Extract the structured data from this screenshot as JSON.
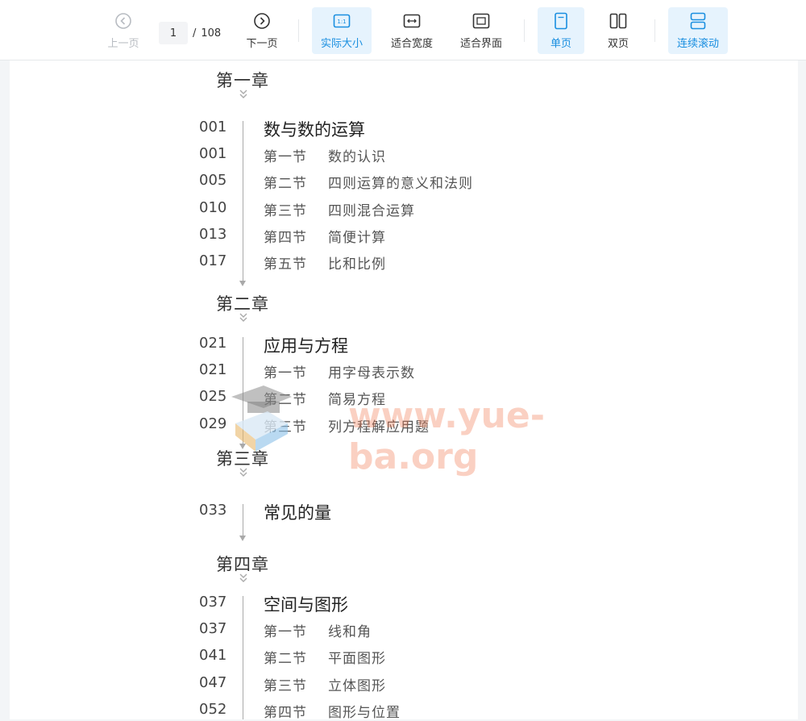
{
  "toolbar": {
    "prev_label": "上一页",
    "next_label": "下一页",
    "current_page": "1",
    "total_pages": "108",
    "actual_size_label": "实际大小",
    "actual_size_icon_text": "1:1",
    "fit_width_label": "适合宽度",
    "fit_screen_label": "适合界面",
    "single_page_label": "单页",
    "double_page_label": "双页",
    "continuous_scroll_label": "连续滚动",
    "accent_color": "#1a8fe0"
  },
  "toc": {
    "chapters": [
      {
        "title": "第一章",
        "main": {
          "page": "001",
          "title": "数与数的运算"
        },
        "sections": [
          {
            "page": "001",
            "label": "第一节",
            "title": "数的认识"
          },
          {
            "page": "005",
            "label": "第二节",
            "title": "四则运算的意义和法则"
          },
          {
            "page": "010",
            "label": "第三节",
            "title": "四则混合运算"
          },
          {
            "page": "013",
            "label": "第四节",
            "title": "简便计算"
          },
          {
            "page": "017",
            "label": "第五节",
            "title": "比和比例"
          }
        ]
      },
      {
        "title": "第二章",
        "main": {
          "page": "021",
          "title": "应用与方程"
        },
        "sections": [
          {
            "page": "021",
            "label": "第一节",
            "title": "用字母表示数"
          },
          {
            "page": "025",
            "label": "第二节",
            "title": "简易方程"
          },
          {
            "page": "029",
            "label": "第三节",
            "title": "列方程解应用题"
          }
        ]
      },
      {
        "title": "第三章",
        "main": {
          "page": "033",
          "title": "常见的量"
        },
        "sections": []
      },
      {
        "title": "第四章",
        "main": {
          "page": "037",
          "title": "空间与图形"
        },
        "sections": [
          {
            "page": "037",
            "label": "第一节",
            "title": "线和角"
          },
          {
            "page": "041",
            "label": "第二节",
            "title": "平面图形"
          },
          {
            "page": "047",
            "label": "第三节",
            "title": "立体图形"
          },
          {
            "page": "052",
            "label": "第四节",
            "title": "图形与位置"
          }
        ]
      }
    ]
  },
  "watermark": {
    "text": "www.yue-ba.org"
  }
}
